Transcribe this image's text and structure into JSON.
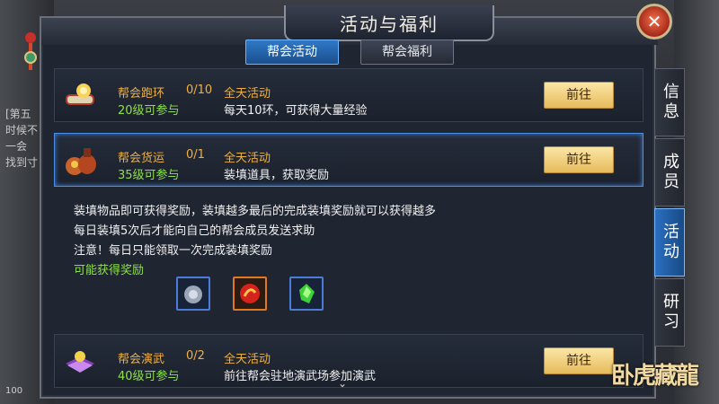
{
  "window": {
    "title": "活动与福利",
    "close_icon": "close-icon"
  },
  "tabs": [
    {
      "label": "帮会活动",
      "active": true
    },
    {
      "label": "帮会福利",
      "active": false
    }
  ],
  "activities": [
    {
      "name": "帮会跑环",
      "count": "0/10",
      "time": "全天活动",
      "level": "20级可参与",
      "desc": "每天10环，可获得大量经验",
      "button": "前往",
      "icon": "scroll-gold-icon"
    },
    {
      "name": "帮会货运",
      "count": "0/1",
      "time": "全天活动",
      "level": "35级可参与",
      "desc": "装填道具，获取奖励",
      "button": "前往",
      "icon": "cargo-bag-icon"
    },
    {
      "name": "帮会演武",
      "count": "0/2",
      "time": "全天活动",
      "level": "40级可参与",
      "desc": "前往帮会驻地演武场参加演武",
      "button": "前往",
      "icon": "martial-book-icon"
    }
  ],
  "detail": {
    "lines": [
      "装填物品即可获得奖励，装填越多最后的完成装填奖励就可以获得越多",
      "每日装填5次后才能向自己的帮会成员发送求助",
      "注意！每日只能领取一次完成装填奖励"
    ],
    "reward_label": "可能获得奖励",
    "rewards": [
      {
        "icon": "silver-coin-pouch-icon",
        "rarity": "blue"
      },
      {
        "icon": "red-orb-icon",
        "rarity": "orange"
      },
      {
        "icon": "green-gem-icon",
        "rarity": "blue"
      }
    ]
  },
  "side_tabs": [
    {
      "label": "信息",
      "active": false
    },
    {
      "label": "成员",
      "active": false
    },
    {
      "label": "活动",
      "active": true
    },
    {
      "label": "研习",
      "active": false
    }
  ],
  "background": {
    "text_1": "[第五",
    "text_2": "时候不",
    "text_3": "一会",
    "text_4": "找到寸",
    "level_badge": "100",
    "logo": "卧虎藏龍"
  },
  "colors": {
    "accent": "#2f79c8",
    "gold": "#f0b040",
    "green": "#8ee04a",
    "button": "#f0cf7a"
  }
}
